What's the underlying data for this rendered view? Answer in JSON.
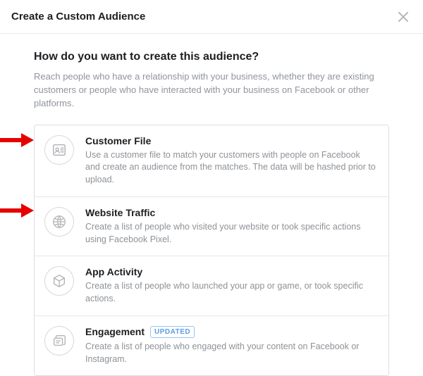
{
  "header": {
    "title": "Create a Custom Audience"
  },
  "intro": {
    "question": "How do you want to create this audience?",
    "subtext": "Reach people who have a relationship with your business, whether they are existing customers or people who have interacted with your business on Facebook or other platforms."
  },
  "options": [
    {
      "title": "Customer File",
      "desc": "Use a customer file to match your customers with people on Facebook and create an audience from the matches. The data will be hashed prior to upload."
    },
    {
      "title": "Website Traffic",
      "desc": "Create a list of people who visited your website or took specific actions using Facebook Pixel."
    },
    {
      "title": "App Activity",
      "desc": "Create a list of people who launched your app or game, or took specific actions."
    },
    {
      "title": "Engagement",
      "badge": "UPDATED",
      "desc": "Create a list of people who engaged with your content on Facebook or Instagram."
    }
  ]
}
